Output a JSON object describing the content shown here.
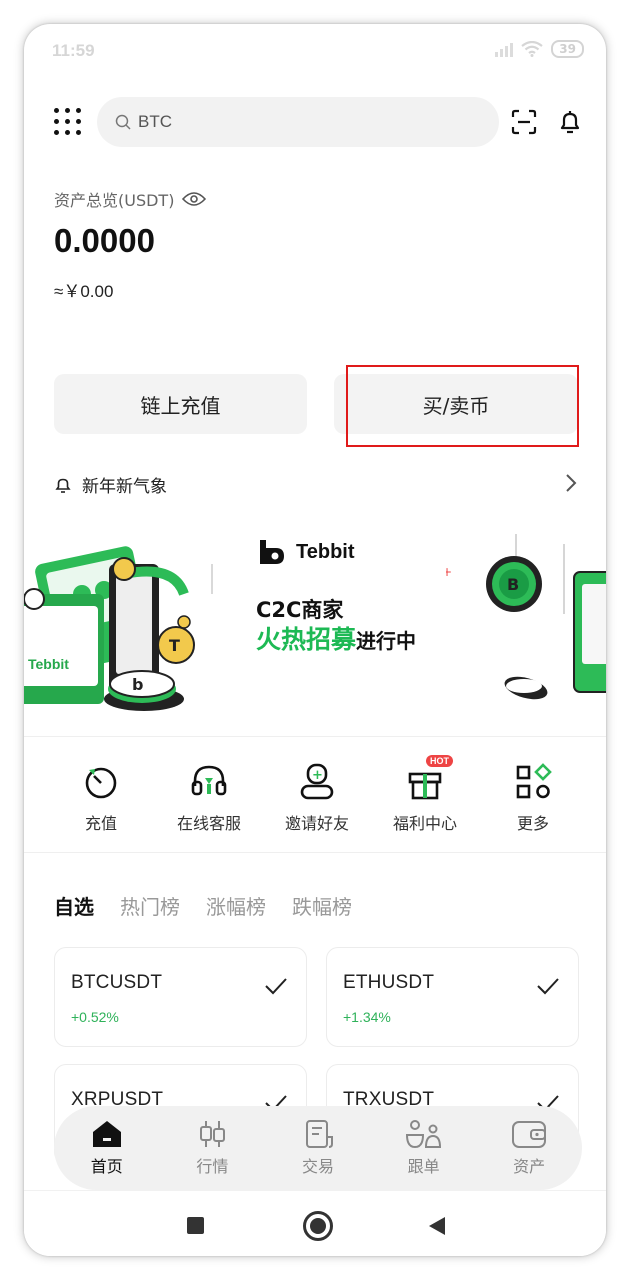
{
  "status_bar": {
    "time": "11:59",
    "battery": "39"
  },
  "search": {
    "placeholder": "BTC"
  },
  "assets": {
    "label": "资产总览(USDT)",
    "value": "0.0000",
    "cny": "≈￥0.00"
  },
  "actions": {
    "deposit_label": "链上充值",
    "buy_sell_label": "买/卖币"
  },
  "announcement": {
    "text": "新年新气象"
  },
  "banner": {
    "brand": "Tebbit",
    "line1": "C2C商家",
    "line2_highlight": "火热招募",
    "line2_suffix": "进行中",
    "accent_color": "#1db954"
  },
  "quick_actions": [
    {
      "label": "充值",
      "icon": "deposit-timer-icon"
    },
    {
      "label": "在线客服",
      "icon": "headset-icon"
    },
    {
      "label": "邀请好友",
      "icon": "invite-user-icon"
    },
    {
      "label": "福利中心",
      "icon": "gift-icon",
      "badge": "HOT"
    },
    {
      "label": "更多",
      "icon": "more-grid-icon"
    }
  ],
  "market_tabs": [
    "自选",
    "热门榜",
    "涨幅榜",
    "跌幅榜"
  ],
  "watchlist": [
    {
      "pair": "BTCUSDT",
      "change": "+0.52%"
    },
    {
      "pair": "ETHUSDT",
      "change": "+1.34%"
    },
    {
      "pair": "XRPUSDT",
      "change": ""
    },
    {
      "pair": "TRXUSDT",
      "change": ""
    }
  ],
  "bottom_nav": [
    {
      "label": "首页",
      "icon": "home-icon",
      "active": true
    },
    {
      "label": "行情",
      "icon": "candlestick-icon"
    },
    {
      "label": "交易",
      "icon": "trade-receipt-icon"
    },
    {
      "label": "跟单",
      "icon": "copy-trade-icon"
    },
    {
      "label": "资产",
      "icon": "wallet-icon"
    }
  ],
  "colors": {
    "positive": "#2fb25a",
    "highlight_border": "#e01a1a"
  }
}
